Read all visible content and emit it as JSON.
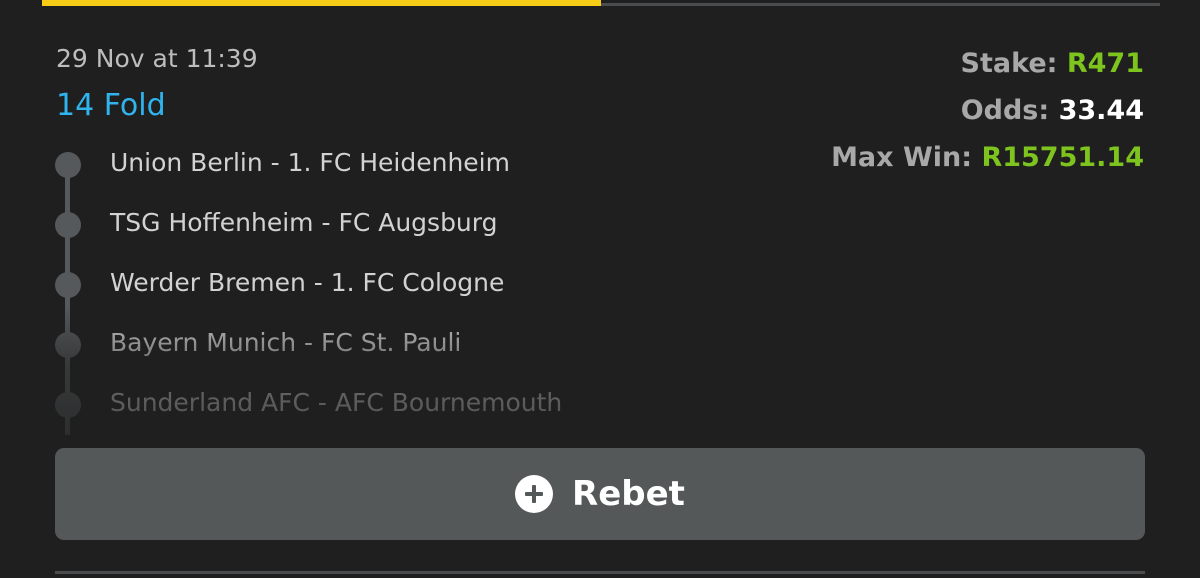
{
  "header": {
    "progress_percent": 50,
    "progress_color": "#f6cc16"
  },
  "bet": {
    "date": "29 Nov at 11:39",
    "type": "14 Fold"
  },
  "summary": {
    "stake_label": "Stake:",
    "stake_value": "R471",
    "odds_label": "Odds:",
    "odds_value": "33.44",
    "max_win_label": "Max Win:",
    "max_win_value": "R15751.14",
    "accent_green": "#7ec41e"
  },
  "legs": [
    {
      "name": "Union Berlin - 1. FC Heidenheim"
    },
    {
      "name": "TSG Hoffenheim - FC Augsburg"
    },
    {
      "name": "Werder Bremen - 1. FC Cologne"
    },
    {
      "name": "Bayern Munich - FC St. Pauli"
    },
    {
      "name": "Sunderland AFC - AFC Bournemouth"
    }
  ],
  "actions": {
    "rebet_label": "Rebet",
    "rebet_icon": "plus-circle-icon"
  }
}
